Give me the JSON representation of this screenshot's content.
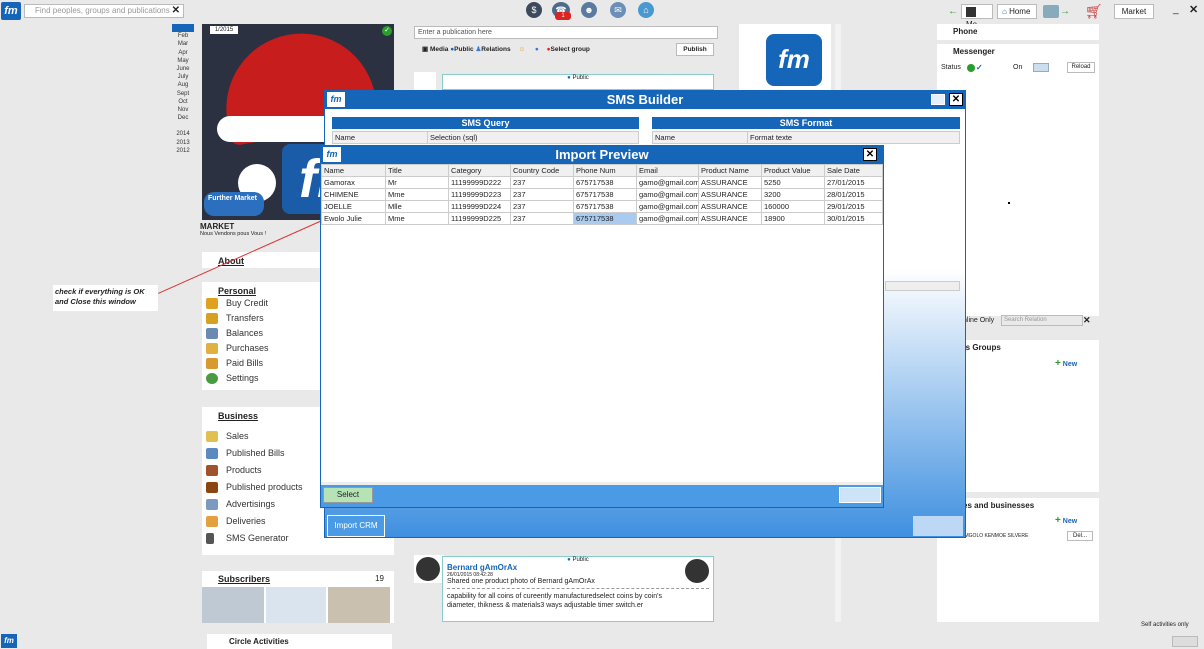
{
  "topbar": {
    "search_placeholder": "Find peoples, groups and publications",
    "badge": "1",
    "me": "Me",
    "home": "Home",
    "market": "Market"
  },
  "months": [
    "2011",
    "Feb",
    "Mar",
    "Apr",
    "May",
    "June",
    "July",
    "Aug",
    "Sept",
    "Oct",
    "Nov",
    "Dec",
    "2014",
    "2013",
    "2012"
  ],
  "cover": {
    "date": "1/2015",
    "name": "MARKET",
    "tagline": "Nous Vendons pous Vous !",
    "badge": "Further Market"
  },
  "callout": "check if everything is OK and Close this window",
  "about": "About",
  "personal": {
    "title": "Personal",
    "items": [
      "Buy Credit",
      "Transfers",
      "Balances",
      "Purchases",
      "Paid Bills",
      "Settings"
    ]
  },
  "business": {
    "title": "Business",
    "items": [
      "Sales",
      "Published Bills",
      "Products",
      "Published products",
      "Advertisings",
      "Deliveries",
      "SMS Generator"
    ]
  },
  "subscribers": {
    "title": "Subscribers",
    "count": "19"
  },
  "circle": "Circle Activities",
  "publication": {
    "placeholder": "Enter a publication here",
    "media": "Media",
    "public": "Public",
    "relations": "Relations",
    "group": "Select group",
    "publish": "Publish"
  },
  "post_top": {
    "visibility": "Public"
  },
  "post": {
    "visibility": "Public",
    "author": "Bernard gAmOrAx",
    "date": "26/01/2015 08:42:28",
    "text1": "Shared one product photo of  Bernard gAmOrAx",
    "text2": "capability for all coins of cureently manufacturedselect coins by coin's diameter, thikness & materials3 ways adjustable timer switch.er"
  },
  "right": {
    "phone": "Phone",
    "messenger": "Messenger",
    "status": "Status",
    "on": "On",
    "reload": "Reload",
    "online_only": "nline Only",
    "search_relation": "Search Relation",
    "groups": "ts Groups",
    "new1": "New",
    "businesses": "es and businesses",
    "new2": "New",
    "person": "DOMGOLO KENMOE SILVERE",
    "del": "Del..."
  },
  "footer": {
    "self": "Self activities only"
  },
  "sms_builder": {
    "title": "SMS Builder",
    "query": "SMS Query",
    "query_cols": [
      "Name",
      "Selection (sql)"
    ],
    "format": "SMS Format",
    "format_cols": [
      "Name",
      "Format texte"
    ],
    "import_btn": "Import CRM"
  },
  "import_preview": {
    "title": "Import Preview",
    "columns": [
      "Name",
      "Title",
      "Category",
      "Country Code",
      "Phone Num",
      "Email",
      "Product Name",
      "Product Value",
      "Sale Date"
    ],
    "rows": [
      [
        "Gamorax",
        "Mr",
        "11199999D222",
        "237",
        "675717538",
        "gamo@gmail.com",
        "ASSURANCE",
        "5250",
        "27/01/2015"
      ],
      [
        "CHIMENE",
        "Mme",
        "11199999D223",
        "237",
        "675717538",
        "gamo@gmail.com",
        "ASSURANCE",
        "3200",
        "28/01/2015"
      ],
      [
        "JOELLE",
        "Mlle",
        "11199999D224",
        "237",
        "675717538",
        "gamo@gmail.com",
        "ASSURANCE",
        "160000",
        "29/01/2015"
      ],
      [
        "Ewolo Julie",
        "Mme",
        "11199999D225",
        "237",
        "675717538",
        "gamo@gmail.com",
        "ASSURANCE",
        "18900",
        "30/01/2015"
      ]
    ],
    "select": "Select"
  }
}
